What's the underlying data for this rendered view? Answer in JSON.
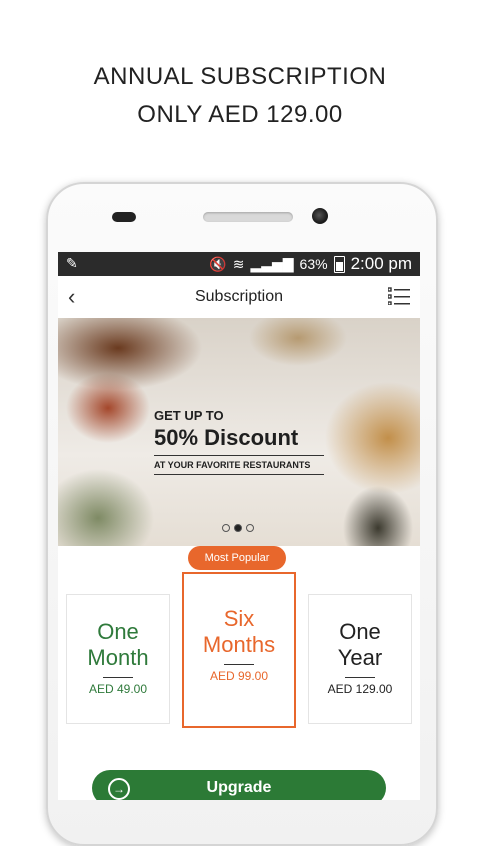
{
  "promo": {
    "line1": "ANNUAL SUBSCRIPTION",
    "line2": "ONLY AED 129.00"
  },
  "status_bar": {
    "battery": "63%",
    "time": "2:00 pm"
  },
  "app_bar": {
    "title": "Subscription"
  },
  "hero": {
    "line1": "GET UP TO",
    "line2": "50% Discount",
    "line3": "AT YOUR FAVORITE RESTAURANTS",
    "carousel_active_index": 1,
    "carousel_count": 3
  },
  "plans": [
    {
      "name_line1": "One",
      "name_line2": "Month",
      "price": "AED 49.00",
      "color": "#2f7a3b"
    },
    {
      "name_line1": "Six",
      "name_line2": "Months",
      "price": "AED 99.00",
      "color": "#e8672c",
      "badge": "Most Popular"
    },
    {
      "name_line1": "One",
      "name_line2": "Year",
      "price": "AED 129.00",
      "color": "#222222"
    }
  ],
  "upgrade": {
    "label": "Upgrade",
    "color": "#2c7a36"
  },
  "icons": {
    "back": "chevron-left-icon",
    "menu": "list-icon",
    "upgrade": "arrow-right-circle-icon"
  }
}
